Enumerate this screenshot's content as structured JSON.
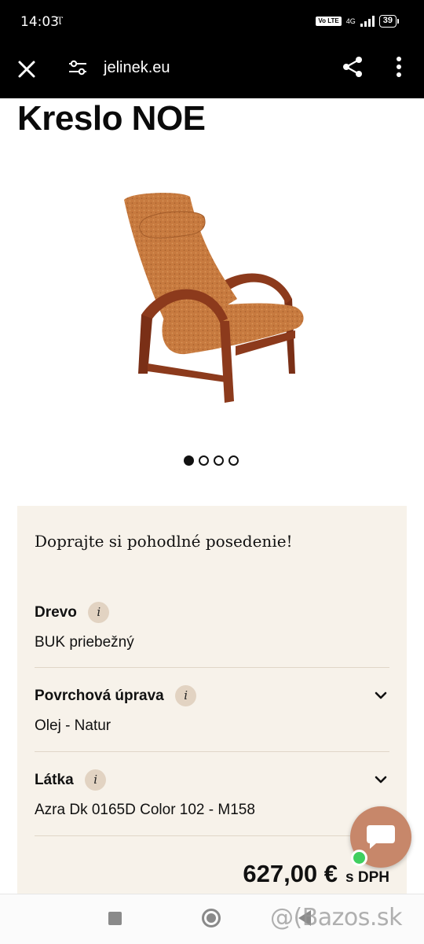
{
  "status_bar": {
    "time": "14:03",
    "extra": "Ⲧ",
    "volte": "Vo LTE",
    "network": "4G",
    "battery": "39"
  },
  "browser": {
    "url": "jelinek.eu"
  },
  "product": {
    "title": "Kreslo NOE",
    "image_alt_colors": {
      "fabric": "#c77a3f",
      "wood": "#8c3a1c"
    },
    "carousel": {
      "count": 4,
      "active": 0
    }
  },
  "panel": {
    "tagline": "Doprajte si pohodlné posedenie!",
    "info_glyph": "i",
    "attributes": [
      {
        "label": "Drevo",
        "value": "BUK priebežný",
        "expandable": false
      },
      {
        "label": "Povrchová úprava",
        "value": "Olej - Natur",
        "expandable": true
      },
      {
        "label": "Látka",
        "value": "Azra Dk 0165D Color 102 - M158",
        "expandable": true
      }
    ],
    "price": "627,00 €",
    "vat_label": "s DPH"
  },
  "watermark": "@(Bazos.sk",
  "colors": {
    "panel_bg": "#f7f2ea",
    "info_badge": "#e2d3c2",
    "chat_fab": "#c7876a",
    "online": "#3fcf5f"
  }
}
